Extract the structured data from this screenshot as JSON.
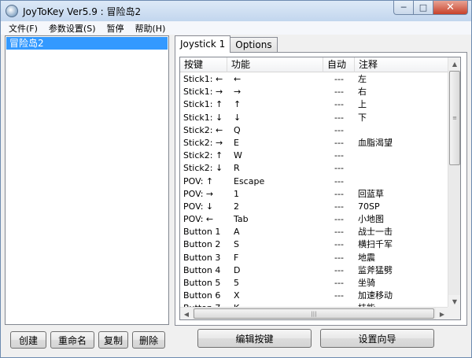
{
  "window": {
    "title": "JoyToKey Ver5.9 : 冒险岛2"
  },
  "titlebar_buttons": {
    "minimize": "─",
    "maximize": "□",
    "close": "✕"
  },
  "menu": [
    "文件(F)",
    "参数设置(S)",
    "暂停",
    "帮助(H)"
  ],
  "profiles": [
    "冒险岛2"
  ],
  "profile_buttons": {
    "create": "创建",
    "rename": "重命名",
    "copy": "复制",
    "delete": "删除"
  },
  "tabs": [
    "Joystick 1",
    "Options"
  ],
  "columns": [
    "按键",
    "功能",
    "自动",
    "注释"
  ],
  "rows": [
    [
      "Stick1: ←",
      "←",
      "---",
      "左"
    ],
    [
      "Stick1: →",
      "→",
      "---",
      "右"
    ],
    [
      "Stick1: ↑",
      "↑",
      "---",
      "上"
    ],
    [
      "Stick1: ↓",
      "↓",
      "---",
      "下"
    ],
    [
      "Stick2: ←",
      "Q",
      "---",
      ""
    ],
    [
      "Stick2: →",
      "E",
      "---",
      "血脂渴望"
    ],
    [
      "Stick2: ↑",
      "W",
      "---",
      ""
    ],
    [
      "Stick2: ↓",
      "R",
      "---",
      ""
    ],
    [
      "POV: ↑",
      "Escape",
      "---",
      ""
    ],
    [
      "POV: →",
      "1",
      "---",
      "回蓝草"
    ],
    [
      "POV: ↓",
      "2",
      "---",
      "70SP"
    ],
    [
      "POV: ←",
      "Tab",
      "---",
      "小地图"
    ],
    [
      "Button 1",
      "A",
      "---",
      "战士一击"
    ],
    [
      "Button 2",
      "S",
      "---",
      "横扫千军"
    ],
    [
      "Button 3",
      "F",
      "---",
      "地震"
    ],
    [
      "Button 4",
      "D",
      "---",
      "监斧猛劈"
    ],
    [
      "Button 5",
      "5",
      "---",
      "坐骑"
    ],
    [
      "Button 6",
      "X",
      "---",
      "加速移动"
    ],
    [
      "Button 7",
      "K",
      "---",
      "技能"
    ]
  ],
  "action_buttons": {
    "edit": "编辑按键",
    "wizard": "设置向导"
  },
  "colors": {
    "selection": "#3399ff",
    "titlebar": "#c2d6ee"
  }
}
